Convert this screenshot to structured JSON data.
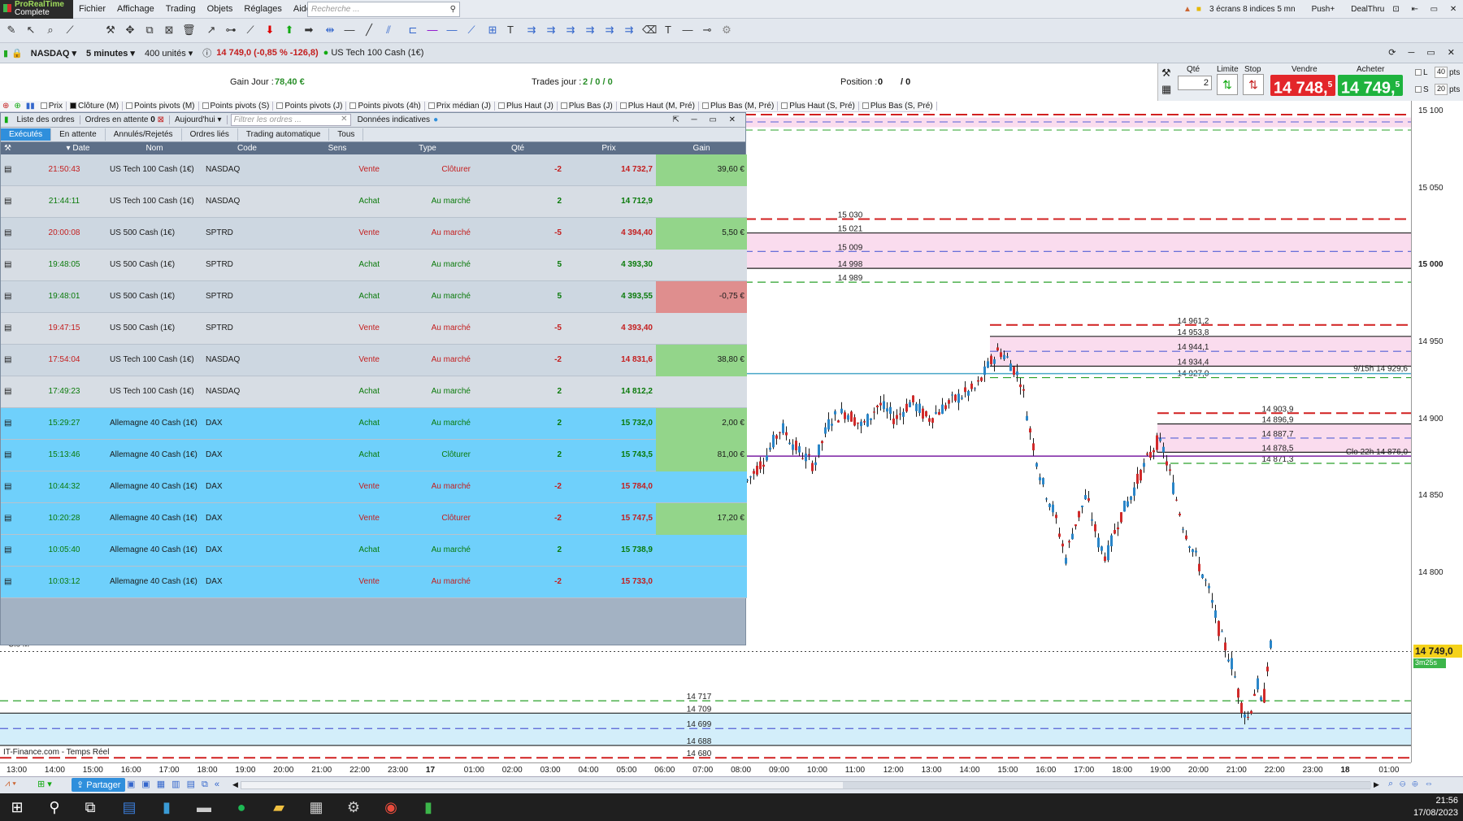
{
  "menubar": {
    "brand_line1": "ProRealTime",
    "brand_line2": "Complete",
    "items": [
      "Fichier",
      "Affichage",
      "Trading",
      "Objets",
      "Réglages",
      "Aide"
    ],
    "search_placeholder": "Recherche ...",
    "screens_label": "3 écrans 8 indices 5 mn",
    "push_label": "Push+",
    "dealthru_label": "DealThru"
  },
  "instrument": {
    "symbol": "NASDAQ",
    "timeframe": "5 minutes",
    "units": "400 unités",
    "quote": "14 749,0 (-0,85 % -126,8)",
    "name": "US Tech 100 Cash (1€)"
  },
  "pnl": {
    "gain_label": "Gain Jour :",
    "gain_value": "78,40 €",
    "trades_label": "Trades jour :",
    "trades_value": "2 / 0 / 0",
    "position_label": "Position :",
    "position_value": "0",
    "position_extra": "/ 0"
  },
  "orderpanel": {
    "qty_label": "Qté",
    "qty_value": "2",
    "limit_label": "Limite",
    "stop_label": "Stop",
    "sell_label": "Vendre",
    "buy_label": "Acheter",
    "sell_price": "14 748,",
    "sell_sup": "5",
    "buy_price": "14 749,",
    "buy_sup": "5",
    "l_label": "L",
    "l_value": "40",
    "s_label": "S",
    "s_value": "20",
    "pts": "pts"
  },
  "indicators": [
    "Prix",
    "Clôture (M)",
    "Points pivots (M)",
    "Points pivots (S)",
    "Points pivots (J)",
    "Points pivots (4h)",
    "Prix médian (J)",
    "Plus Haut (J)",
    "Plus Bas (J)",
    "Plus Haut (M, Pré)",
    "Plus Bas (M, Pré)",
    "Plus Haut (S, Pré)",
    "Plus Bas (S, Pré)"
  ],
  "orders_panel": {
    "header_title": "Liste des ordres",
    "pending_tab": "Ordres en attente",
    "pending_count": "0",
    "date_filter": "Aujourd'hui",
    "filter_placeholder": "Filtrer les ordres ...",
    "data_label": "Données indicatives",
    "tabs": [
      "Exécutés",
      "En attente",
      "Annulés/Rejetés",
      "Ordres liés",
      "Trading automatique",
      "Tous"
    ],
    "columns": [
      "Date",
      "Nom",
      "Code",
      "Sens",
      "Type",
      "Qté",
      "Prix",
      "Gain"
    ],
    "rows": [
      {
        "time": "21:50:43",
        "name": "US Tech 100 Cash (1€)",
        "code": "NASDAQ",
        "side": "Vente",
        "type": "Clôturer",
        "qty": "-2",
        "price": "14 732,7",
        "gain": "39,60 €"
      },
      {
        "time": "21:44:11",
        "name": "US Tech 100 Cash (1€)",
        "code": "NASDAQ",
        "side": "Achat",
        "type": "Au marché",
        "qty": "2",
        "price": "14 712,9",
        "gain": ""
      },
      {
        "time": "20:00:08",
        "name": "US 500 Cash (1€)",
        "code": "SPTRD",
        "side": "Vente",
        "type": "Au marché",
        "qty": "-5",
        "price": "4 394,40",
        "gain": "5,50 €"
      },
      {
        "time": "19:48:05",
        "name": "US 500 Cash (1€)",
        "code": "SPTRD",
        "side": "Achat",
        "type": "Au marché",
        "qty": "5",
        "price": "4 393,30",
        "gain": ""
      },
      {
        "time": "19:48:01",
        "name": "US 500 Cash (1€)",
        "code": "SPTRD",
        "side": "Achat",
        "type": "Au marché",
        "qty": "5",
        "price": "4 393,55",
        "gain": "-0,75 €"
      },
      {
        "time": "19:47:15",
        "name": "US 500 Cash (1€)",
        "code": "SPTRD",
        "side": "Vente",
        "type": "Au marché",
        "qty": "-5",
        "price": "4 393,40",
        "gain": ""
      },
      {
        "time": "17:54:04",
        "name": "US Tech 100 Cash (1€)",
        "code": "NASDAQ",
        "side": "Vente",
        "type": "Au marché",
        "qty": "-2",
        "price": "14 831,6",
        "gain": "38,80 €"
      },
      {
        "time": "17:49:23",
        "name": "US Tech 100 Cash (1€)",
        "code": "NASDAQ",
        "side": "Achat",
        "type": "Au marché",
        "qty": "2",
        "price": "14 812,2",
        "gain": ""
      },
      {
        "time": "15:29:27",
        "name": "Allemagne 40 Cash (1€)",
        "code": "DAX",
        "side": "Achat",
        "type": "Au marché",
        "qty": "2",
        "price": "15 732,0",
        "gain": "2,00 €"
      },
      {
        "time": "15:13:46",
        "name": "Allemagne 40 Cash (1€)",
        "code": "DAX",
        "side": "Achat",
        "type": "Clôturer",
        "qty": "2",
        "price": "15 743,5",
        "gain": "81,00 €"
      },
      {
        "time": "10:44:32",
        "name": "Allemagne 40 Cash (1€)",
        "code": "DAX",
        "side": "Vente",
        "type": "Au marché",
        "qty": "-2",
        "price": "15 784,0",
        "gain": ""
      },
      {
        "time": "10:20:28",
        "name": "Allemagne 40 Cash (1€)",
        "code": "DAX",
        "side": "Vente",
        "type": "Clôturer",
        "qty": "-2",
        "price": "15 747,5",
        "gain": "17,20 €"
      },
      {
        "time": "10:05:40",
        "name": "Allemagne 40 Cash (1€)",
        "code": "DAX",
        "side": "Achat",
        "type": "Au marché",
        "qty": "2",
        "price": "15 738,9",
        "gain": ""
      },
      {
        "time": "10:03:12",
        "name": "Allemagne 40 Cash (1€)",
        "code": "DAX",
        "side": "Vente",
        "type": "Au marché",
        "qty": "-2",
        "price": "15 733,0",
        "gain": ""
      }
    ]
  },
  "chart": {
    "y_ticks": [
      "15 100",
      "15 050",
      "15 000",
      "14 950",
      "14 900",
      "14 850",
      "14 800"
    ],
    "y_values": [
      15100,
      15050,
      15000,
      14950,
      14900,
      14850,
      14800
    ],
    "last_price_label": "14 749,0",
    "countdown": "3m25s",
    "x_labels": [
      "13:00",
      "14:00",
      "15:00",
      "16:00",
      "17:00",
      "18:00",
      "19:00",
      "20:00",
      "21:00",
      "22:00",
      "23:00",
      "17",
      "01:00",
      "02:00",
      "03:00",
      "04:00",
      "05:00",
      "06:00",
      "07:00",
      "08:00",
      "09:00",
      "10:00",
      "11:00",
      "12:00",
      "13:00",
      "14:00",
      "15:00",
      "16:00",
      "17:00",
      "18:00",
      "19:00",
      "20:00",
      "21:00",
      "22:00",
      "23:00",
      "18",
      "01:00"
    ],
    "levels": [
      {
        "label": "15 030",
        "value": 15030
      },
      {
        "label": "15 021",
        "value": 15021
      },
      {
        "label": "15 009",
        "value": 15009
      },
      {
        "label": "14 998",
        "value": 14998
      },
      {
        "label": "14 989",
        "value": 14989
      },
      {
        "label": "14 961,2",
        "value": 14961.2
      },
      {
        "label": "14 953,8",
        "value": 14953.8
      },
      {
        "label": "14 944,1",
        "value": 14944.1
      },
      {
        "label": "14 934,4",
        "value": 14934.4
      },
      {
        "label": "14 927,0",
        "value": 14927
      },
      {
        "label": "14 903,9",
        "value": 14903.9
      },
      {
        "label": "14 896,9",
        "value": 14896.9
      },
      {
        "label": "14 887,7",
        "value": 14887.7
      },
      {
        "label": "14 878,5",
        "value": 14878.5
      },
      {
        "label": "14 871,3",
        "value": 14871.3
      },
      {
        "label": "14 717",
        "value": 14717
      },
      {
        "label": "14 709",
        "value": 14709
      },
      {
        "label": "14 699",
        "value": 14699
      },
      {
        "label": "14 688",
        "value": 14688
      },
      {
        "label": "14 680",
        "value": 14680
      }
    ],
    "annotations": {
      "close_m": "Clo M",
      "pivot_label": "9/15h 14 929,6",
      "clo22_label": "Clo 22h 14 876,0",
      "source": "IT-Finance.com - Temps Réel"
    }
  },
  "bottombar": {
    "share_label": "Partager"
  },
  "taskbar": {
    "time": "21:56",
    "date": "17/08/2023"
  }
}
